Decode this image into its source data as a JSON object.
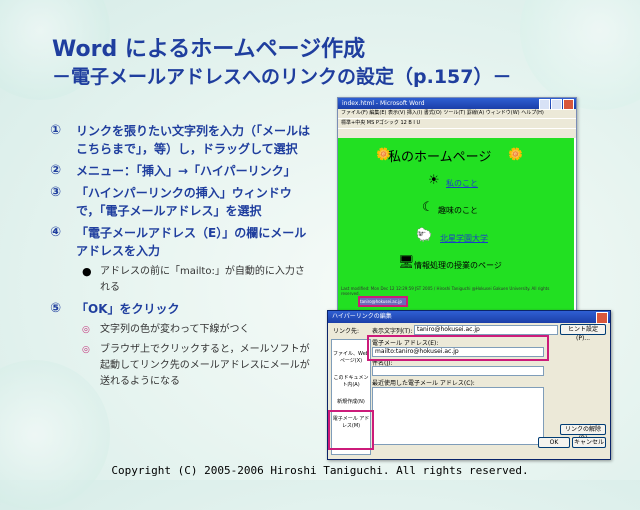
{
  "title": {
    "line1": "Word によるホームページ作成",
    "line2": "－電子メールアドレスへのリンクの設定（p.157）－"
  },
  "steps": [
    {
      "num": "①",
      "text": "リンクを張りたい文字列を入力（「メールはこちらまで」，等）し，ドラッグして選択"
    },
    {
      "num": "②",
      "text": "メニュー：「挿入」→「ハイパーリンク」"
    },
    {
      "num": "③",
      "text": "「ハインパーリンクの挿入」ウィンドウで，「電子メールアドレス」を選択"
    },
    {
      "num": "④",
      "text": "「電子メールアドレス（E）」の欄にメールアドレスを入力"
    }
  ],
  "step4_sub": "アドレスの前に「mailto:」が自動的に入力される",
  "step5": {
    "num": "⑤",
    "text": "「OK」をクリック"
  },
  "step5_subs": [
    "文字列の色が変わって下線がつく",
    "ブラウザ上でクリックすると，メールソフトが起動してリンク先のメールアドレスにメールが送れるようになる"
  ],
  "word": {
    "window_title": "index.html - Microsoft Word",
    "menu": "ファイル(F)  編集(E)  表示(V)  挿入(I)  書式(O)  ツール(T)  罫線(A)  ウィンドウ(W)  ヘルプ(H)",
    "toolbar": "標準+中央  MS Pゴシック  12  B  I  U",
    "home_title": "私のホームページ",
    "links": [
      "私のこと",
      "趣味のこと",
      "北星学園大学",
      "情報処理の授業のページ"
    ],
    "footer": "Last modified: Mon Dec 12 12:29:59 JST 2005 / Hiroshi Taniguchi @Hokusei Gakuen University. All rights reserved.",
    "selected_mail": "taniro@hokusei.ac.jp"
  },
  "dialog": {
    "title": "ハイパーリンクの編集",
    "link_to_label": "リンク先:",
    "display_text_label": "表示文字列(T):",
    "display_text_value": "taniro@hokusei.ac.jp",
    "screen_tip": "ヒント設定(P)...",
    "email_label": "電子メール アドレス(E):",
    "email_value": "mailto:taniro@hokusei.ac.jp",
    "subject_label": "件名(J):",
    "recent_label": "最近使用した電子メール アドレス(C):",
    "side_items": [
      "ファイル、Web ページ(X)",
      "このドキュメント内(A)",
      "新規作成(N)",
      "電子メール アドレス(M)"
    ],
    "remove_link": "リンクの解除(R)",
    "ok": "OK",
    "cancel": "キャンセル"
  },
  "copyright": "Copyright (C) 2005-2006 Hiroshi Taniguchi. All rights reserved."
}
